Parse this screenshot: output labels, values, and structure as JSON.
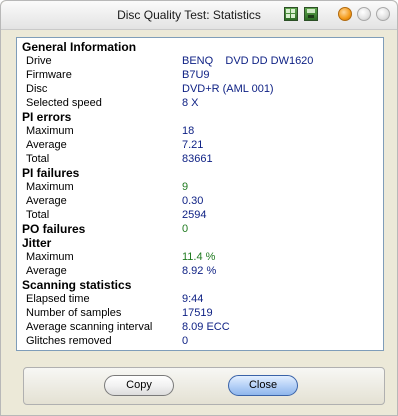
{
  "window": {
    "title": "Disc Quality Test: Statistics"
  },
  "sections": {
    "general": {
      "heading": "General Information",
      "rows": [
        {
          "label": "Drive",
          "value": "BENQ    DVD DD DW1620"
        },
        {
          "label": "Firmware",
          "value": "B7U9"
        },
        {
          "label": "Disc",
          "value": "DVD+R (AML 001)"
        },
        {
          "label": "Selected speed",
          "value": "8 X"
        }
      ]
    },
    "pi_errors": {
      "heading": "PI errors",
      "rows": [
        {
          "label": "Maximum",
          "value": "18"
        },
        {
          "label": "Average",
          "value": "7.21"
        },
        {
          "label": "Total",
          "value": "83661"
        }
      ]
    },
    "pi_failures": {
      "heading": "PI failures",
      "rows": [
        {
          "label": "Maximum",
          "value": "9"
        },
        {
          "label": "Average",
          "value": "0.30"
        },
        {
          "label": "Total",
          "value": "2594"
        }
      ]
    },
    "po_failures": {
      "heading": "PO failures",
      "value": "0"
    },
    "jitter": {
      "heading": "Jitter",
      "rows": [
        {
          "label": "Maximum",
          "value": "11.4 %"
        },
        {
          "label": "Average",
          "value": "8.92 %"
        }
      ]
    },
    "scanning": {
      "heading": "Scanning statistics",
      "rows": [
        {
          "label": "Elapsed time",
          "value": "9:44"
        },
        {
          "label": "Number of samples",
          "value": "17519"
        },
        {
          "label": "Average scanning interval",
          "value": "8.09 ECC"
        },
        {
          "label": "Glitches removed",
          "value": "0"
        }
      ]
    }
  },
  "buttons": {
    "copy": "Copy",
    "close": "Close"
  },
  "icons": {
    "titlebar_left": "grid-icon",
    "titlebar_right": "save-icon"
  }
}
